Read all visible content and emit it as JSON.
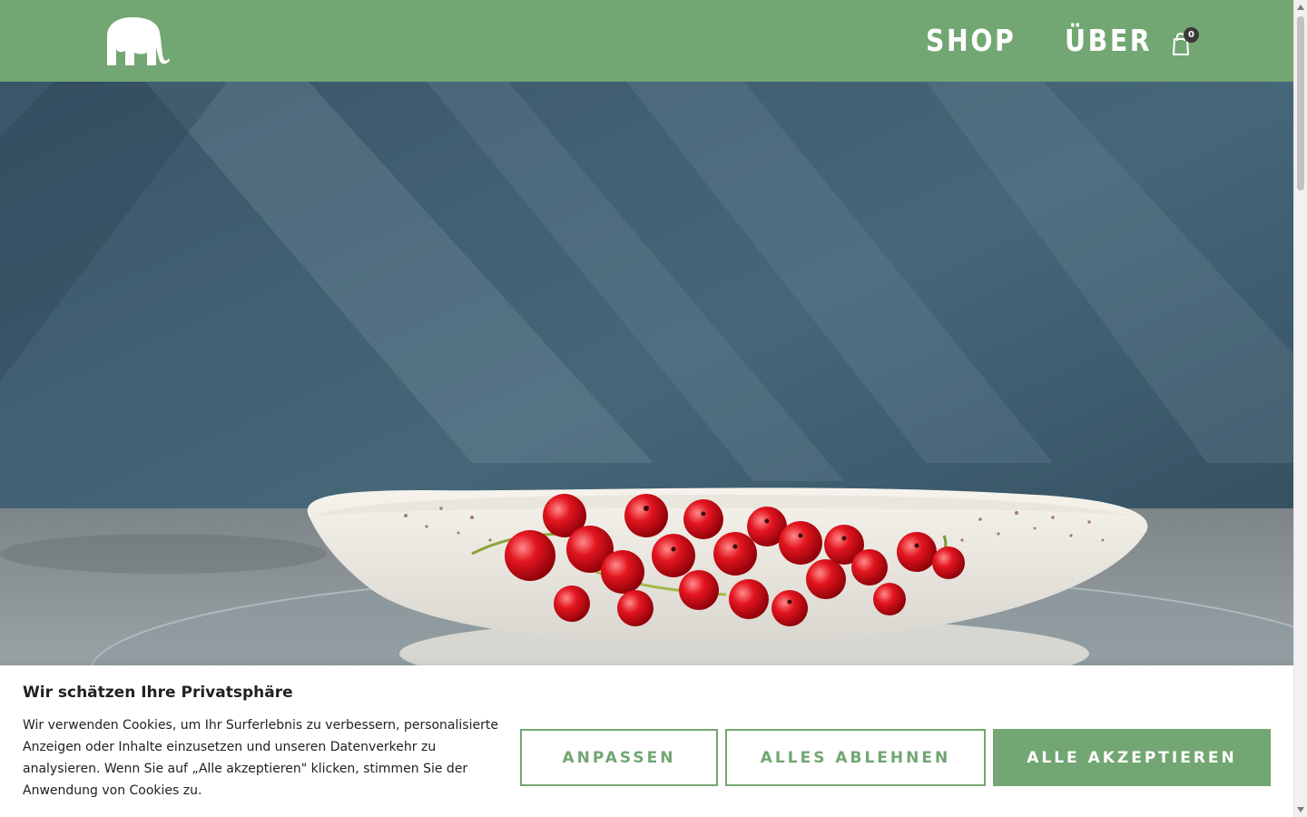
{
  "header": {
    "logo_icon": "elephant-logo-icon",
    "nav": {
      "shop_label": "SHOP",
      "about_label": "ÜBER"
    },
    "cart": {
      "icon": "shopping-bag-icon",
      "count": "0"
    }
  },
  "hero": {
    "image": "red currants in white speckled ceramic bowl on blue textured background"
  },
  "cookie_banner": {
    "title": "Wir schätzen Ihre Privatsphäre",
    "text": "Wir verwenden Cookies, um Ihr Surferlebnis zu verbessern, personalisierte Anzeigen oder Inhalte einzusetzen und unseren Datenverkehr zu analysieren. Wenn Sie auf „Alle akzeptieren\" klicken, stimmen Sie der Anwendung von Cookies zu.",
    "buttons": {
      "customize_label": "ANPASSEN",
      "reject_label": "ALLES ABLEHNEN",
      "accept_label": "ALLE AKZEPTIEREN"
    }
  },
  "colors": {
    "brand_green": "#72a672",
    "text_dark": "#212121",
    "hero_wall": "#3c5a6c"
  }
}
